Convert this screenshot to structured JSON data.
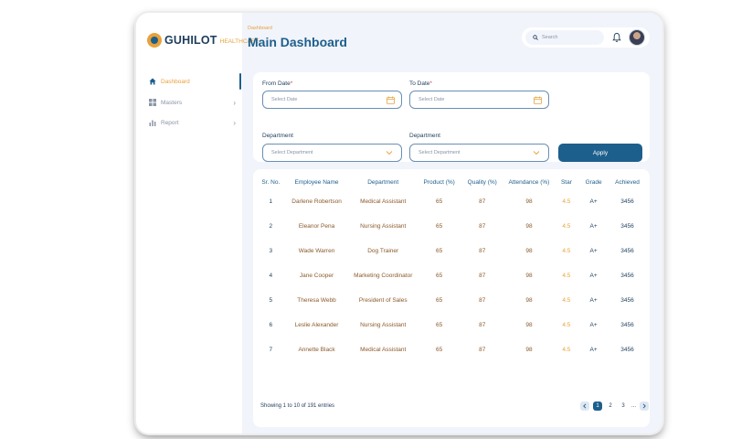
{
  "brand": {
    "name": "GUHILOT",
    "sub": "HEALTHCARE",
    "accent": "#e8a23c",
    "primary": "#1d5f8c"
  },
  "sidebar": {
    "items": [
      {
        "label": "Dashboard",
        "icon": "home-icon",
        "active": true
      },
      {
        "label": "Masters",
        "icon": "grid-icon",
        "active": false
      },
      {
        "label": "Report",
        "icon": "bar-chart-icon",
        "active": false
      }
    ]
  },
  "header": {
    "breadcrumb": "Dashboard",
    "title": "Main Dashboard",
    "search_placeholder": "Search"
  },
  "filters": {
    "from_date_label": "From Date",
    "to_date_label": "To Date",
    "required_mark": "*",
    "date_placeholder": "Select Date",
    "department_label": "Department",
    "department_placeholder": "Select Department",
    "apply_label": "Apply"
  },
  "table": {
    "columns": [
      "Sr. No.",
      "Employee Name",
      "Department",
      "Product (%)",
      "Quality (%)",
      "Attendance (%)",
      "Star",
      "Grade",
      "Achieved"
    ],
    "rows": [
      [
        "1",
        "Darlene Robertson",
        "Medical Assistant",
        "65",
        "87",
        "98",
        "4.5",
        "A+",
        "3456"
      ],
      [
        "2",
        "Eleanor Pena",
        "Nursing Assistant",
        "65",
        "87",
        "98",
        "4.5",
        "A+",
        "3456"
      ],
      [
        "3",
        "Wade Warren",
        "Dog Trainer",
        "65",
        "87",
        "98",
        "4.5",
        "A+",
        "3456"
      ],
      [
        "4",
        "Jane Cooper",
        "Marketing Coordinator",
        "65",
        "87",
        "98",
        "4.5",
        "A+",
        "3456"
      ],
      [
        "5",
        "Theresa Webb",
        "President of Sales",
        "65",
        "87",
        "98",
        "4.5",
        "A+",
        "3456"
      ],
      [
        "6",
        "Leslie Alexander",
        "Nursing Assistant",
        "65",
        "87",
        "98",
        "4.5",
        "A+",
        "3456"
      ],
      [
        "7",
        "Annette Black",
        "Medical Assistant",
        "65",
        "87",
        "98",
        "4.5",
        "A+",
        "3456"
      ]
    ],
    "footer": "Showing 1 to 10 of 191 entries"
  },
  "pagination": {
    "pages": [
      "1",
      "2",
      "3"
    ],
    "current": "1",
    "ellipsis": "..."
  }
}
